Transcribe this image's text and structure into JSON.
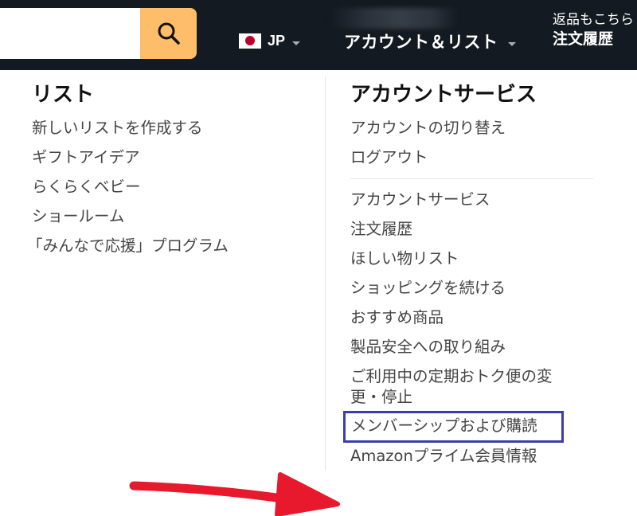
{
  "navbar": {
    "search": {
      "value": "",
      "placeholder": ""
    },
    "language": {
      "code": "JP"
    },
    "account": {
      "label": "アカウント＆リスト"
    },
    "returns": {
      "line1": "返品もこちら",
      "line2": "注文履歴"
    }
  },
  "dropdown": {
    "lists": {
      "heading": "リスト",
      "items": [
        {
          "label": "新しいリストを作成する"
        },
        {
          "label": "ギフトアイデア"
        },
        {
          "label": "らくらくベビー"
        },
        {
          "label": "ショールーム"
        },
        {
          "label": "「みんなで応援」プログラム"
        }
      ]
    },
    "account_services": {
      "heading": "アカウントサービス",
      "items_top": [
        {
          "label": "アカウントの切り替え"
        },
        {
          "label": "ログアウト"
        }
      ],
      "items": [
        {
          "label": "アカウントサービス"
        },
        {
          "label": "注文履歴"
        },
        {
          "label": "ほしい物リスト"
        },
        {
          "label": "ショッピングを続ける"
        },
        {
          "label": "おすすめ商品"
        },
        {
          "label": "製品安全への取り組み"
        },
        {
          "label": "ご利用中の定期おトク便の変",
          "label_line2": "更・停止"
        },
        {
          "label": "メンバーシップおよび購読"
        },
        {
          "label": "Amazonプライム会員情報"
        }
      ]
    }
  },
  "colors": {
    "navbar_bg": "#131a22",
    "search_button": "#febd69",
    "highlight_box": "#3a3eaa",
    "annotation_arrow": "#e8192c"
  }
}
